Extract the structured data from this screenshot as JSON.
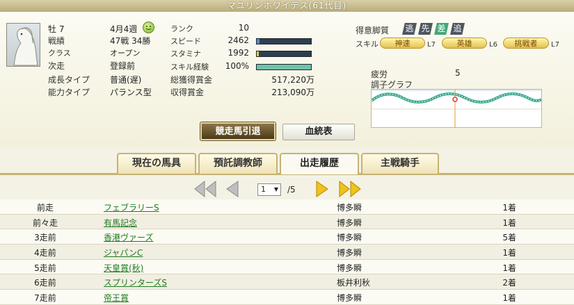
{
  "window": {
    "title": "マユリンホワイテス(61代目)"
  },
  "profile": {
    "sex_age": "牡 7",
    "record_label": "戦績",
    "record_value": "47戦 34勝",
    "class_label": "クラス",
    "class_value": "オープン",
    "next_label": "次走",
    "next_value": "登録前",
    "growth_label": "成長タイプ",
    "growth_value": "普通(遅)",
    "ability_label": "能力タイプ",
    "ability_value": "パランス型",
    "date": "4月4週"
  },
  "stats": {
    "rank_label": "ランク",
    "rank_value": "10",
    "speed_label": "スピード",
    "speed_value": "2462",
    "speed_fill": 0.05,
    "stamina_label": "スタミナ",
    "stamina_value": "1992",
    "stamina_fill": 0.04,
    "skillexp_label": "スキル経験",
    "skillexp_value": "100%",
    "skillexp_fill": 1.0,
    "total_prize_label": "総獲得賞金",
    "total_prize_value": "517,220万",
    "earned_prize_label": "収得賞金",
    "earned_prize_value": "213,090万"
  },
  "legs": {
    "label": "得意脚質",
    "items": [
      {
        "label": "逃",
        "active": false
      },
      {
        "label": "先",
        "active": false
      },
      {
        "label": "差",
        "active": true
      },
      {
        "label": "追",
        "active": false
      }
    ]
  },
  "skills": {
    "label": "スキル",
    "items": [
      {
        "name": "神速",
        "level": "L7"
      },
      {
        "name": "英雄",
        "level": "L6"
      },
      {
        "name": "挑戦者",
        "level": "L7"
      }
    ]
  },
  "condition": {
    "fatigue_label": "疲労",
    "fatigue_value": "5",
    "graph_label": "調子グラフ"
  },
  "buttons": {
    "retire": "競走馬引退",
    "pedigree": "血統表"
  },
  "tabs": [
    {
      "label": "現在の馬具",
      "active": false
    },
    {
      "label": "預託調教師",
      "active": false
    },
    {
      "label": "出走履歴",
      "active": true
    },
    {
      "label": "主戦騎手",
      "active": false
    }
  ],
  "pager": {
    "page": "1",
    "total": "/5"
  },
  "history": [
    {
      "when": "前走",
      "race": "フェブラリーS",
      "jockey": "博多瞬",
      "result": "1着"
    },
    {
      "when": "前々走",
      "race": "有馬記念",
      "jockey": "博多瞬",
      "result": "1着"
    },
    {
      "when": "3走前",
      "race": "香港ヴァーズ",
      "jockey": "博多瞬",
      "result": "5着"
    },
    {
      "when": "4走前",
      "race": "ジャパンC",
      "jockey": "博多瞬",
      "result": "1着"
    },
    {
      "when": "5走前",
      "race": "天皇賞(秋)",
      "jockey": "博多瞬",
      "result": "1着"
    },
    {
      "when": "6走前",
      "race": "スプリンターズS",
      "jockey": "板井利秋",
      "result": "2着"
    },
    {
      "when": "7走前",
      "race": "帝王賞",
      "jockey": "博多瞬",
      "result": "1着"
    }
  ],
  "colors": {
    "speed_bar": "#4f8fcf",
    "stamina_bar": "#e8d23a",
    "skillexp_bar": "#6fc2a8",
    "leg_inactive": "#4e5660",
    "leg_active": "#46a57a"
  }
}
